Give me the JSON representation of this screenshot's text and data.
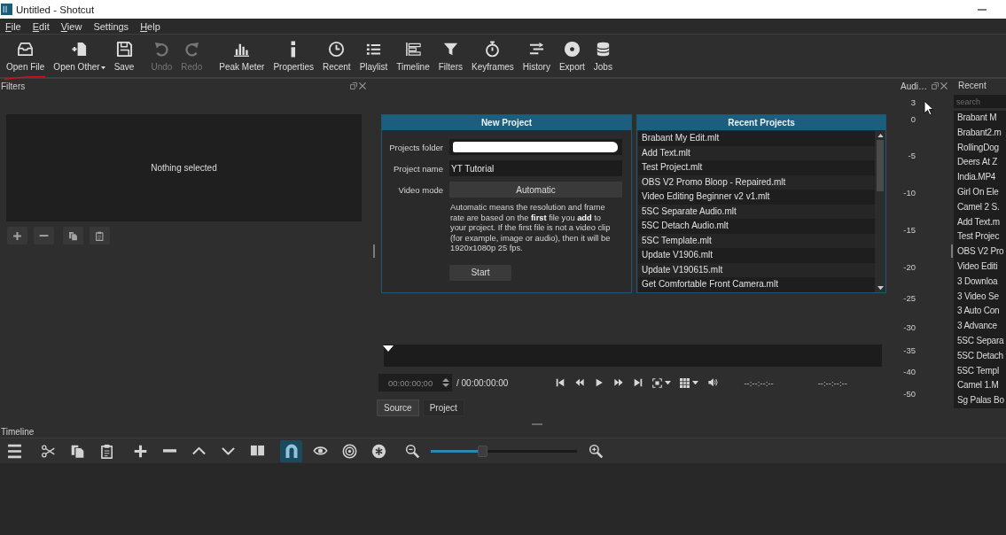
{
  "window": {
    "title": "Untitled - Shotcut"
  },
  "menu": [
    {
      "label": "File",
      "underlined_first": true
    },
    {
      "label": "Edit",
      "underlined_first": true
    },
    {
      "label": "View",
      "underlined_first": true
    },
    {
      "label": "Settings",
      "underlined_first": false
    },
    {
      "label": "Help",
      "underlined_first": true
    }
  ],
  "toolbar": [
    {
      "label": "Open File",
      "disabled": false,
      "dropdown": false
    },
    {
      "label": "Open Other",
      "disabled": false,
      "dropdown": true
    },
    {
      "label": "Save",
      "disabled": false,
      "dropdown": false
    },
    {
      "label": "Undo",
      "disabled": true,
      "dropdown": false
    },
    {
      "label": "Redo",
      "disabled": true,
      "dropdown": false
    },
    {
      "label": "Peak Meter",
      "disabled": false,
      "dropdown": false
    },
    {
      "label": "Properties",
      "disabled": false,
      "dropdown": false
    },
    {
      "label": "Recent",
      "disabled": false,
      "dropdown": false
    },
    {
      "label": "Playlist",
      "disabled": false,
      "dropdown": false
    },
    {
      "label": "Timeline",
      "disabled": false,
      "dropdown": false
    },
    {
      "label": "Filters",
      "disabled": false,
      "dropdown": false
    },
    {
      "label": "Keyframes",
      "disabled": false,
      "dropdown": false
    },
    {
      "label": "History",
      "disabled": false,
      "dropdown": false
    },
    {
      "label": "Export",
      "disabled": false,
      "dropdown": false
    },
    {
      "label": "Jobs",
      "disabled": false,
      "dropdown": false
    }
  ],
  "filters_panel": {
    "title": "Filters",
    "message": "Nothing selected"
  },
  "new_project": {
    "title": "New Project",
    "fields": [
      {
        "kind": "redacted",
        "label": "Projects folder"
      },
      {
        "kind": "text",
        "label": "Project name",
        "value": "YT Tutorial"
      },
      {
        "kind": "choice",
        "label": "Video mode",
        "value": "Automatic"
      }
    ],
    "description": "Automatic means the resolution and frame rate are based on the **first** file you **add** to your project. If the first file is not a video clip (for example, image or audio), then it will be 1920x1080p 25 fps.",
    "start_button": "Start"
  },
  "recent_projects": {
    "title": "Recent Projects",
    "items": [
      "Brabant My Edit.mlt",
      "Add Text.mlt",
      "Test Project.mlt",
      "OBS V2 Promo Bloop - Repaired.mlt",
      "Video Editing Beginner v2 v1.mlt",
      "5SC Separate Audio.mlt",
      "5SC Detach Audio.mlt",
      "5SC Template.mlt",
      "Update V1906.mlt",
      "Update V190615.mlt",
      "Get Comfortable Front Camera.mlt"
    ]
  },
  "player": {
    "timecode": "00:00:00;00",
    "duration": "/ 00:00:00:00",
    "in_point": "--:--:--:--",
    "out_point": "--:--:--:--",
    "tabs": [
      {
        "label": "Source",
        "selected": true
      },
      {
        "label": "Project",
        "selected": false
      }
    ]
  },
  "audio_meter": {
    "title": "Audi…",
    "scale": [
      "3",
      "0",
      "-5",
      "-10",
      "-15",
      "-20",
      "-25",
      "-30",
      "-35",
      "-40",
      "-50"
    ]
  },
  "recent_panel": {
    "title": "Recent",
    "search": {
      "placeholder": "search"
    },
    "items": [
      "Brabant M",
      "Brabant2.m",
      "RollingDog",
      "Deers At Z",
      "India.MP4",
      "Girl On Ele",
      "Camel 2 S.",
      "Add Text.m",
      "Test Projec",
      "OBS V2 Pro",
      "Video Editi",
      "3 Downloa",
      "3 Video Se",
      "3 Auto Con",
      "3 Advance",
      "5SC Separa",
      "5SC Detach",
      "5SC Templ",
      "Camel 1.M",
      "Sg Palas Bo"
    ]
  },
  "timeline": {
    "title": "Timeline",
    "tools": [
      {
        "on": false
      },
      {
        "on": false
      },
      {
        "on": false
      },
      {
        "on": false
      },
      {
        "on": false
      },
      {
        "on": false
      },
      {
        "on": false
      },
      {
        "on": false
      },
      {
        "on": false
      },
      {
        "on": true
      },
      {
        "on": false
      },
      {
        "on": false
      },
      {
        "on": false
      }
    ],
    "zoom": {
      "level": 0.35
    }
  }
}
